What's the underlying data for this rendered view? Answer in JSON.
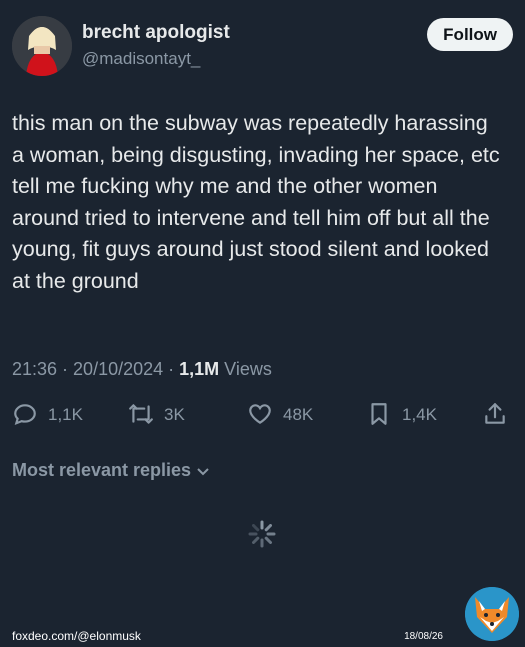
{
  "author": {
    "display_name": "brecht apologist",
    "handle": "@madisontayt_",
    "follow_label": "Follow"
  },
  "tweet": {
    "text": "this man on the subway was repeatedly harassing a woman, being disgusting, invading her space, etc\ntell me fucking why me and the other women around tried to intervene and tell him off but all the young, fit guys around just stood silent and looked at the ground"
  },
  "meta": {
    "time": "21:36",
    "sep1": " · ",
    "date": "20/10/2024",
    "sep2": " · ",
    "views_count": "1,1M",
    "views_label": " Views"
  },
  "actions": {
    "replies": "1,1K",
    "reposts": "3K",
    "likes": "48K",
    "bookmarks": "1,4K"
  },
  "replies_sort": {
    "label": "Most relevant replies"
  },
  "footer": {
    "handle": "foxdeo.com/@elonmusk",
    "date": "18/08/26"
  },
  "colors": {
    "background": "#1b2430",
    "text": "#e7e9ea",
    "muted": "#8b98a5",
    "follow_bg": "#eff3f4"
  },
  "icons": [
    "reply-icon",
    "repost-icon",
    "like-icon",
    "bookmark-icon",
    "share-icon",
    "chevron-down-icon",
    "loading-spinner-icon",
    "fox-logo"
  ]
}
